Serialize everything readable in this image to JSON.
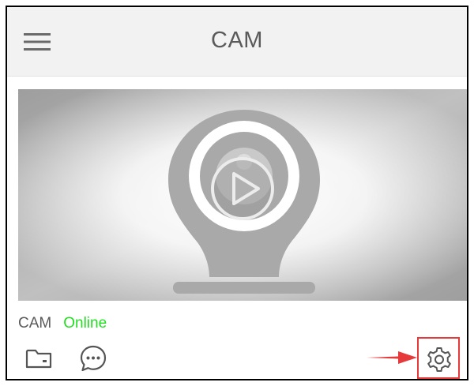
{
  "header": {
    "title": "CAM",
    "menu_icon": "hamburger-menu-icon"
  },
  "preview": {
    "placeholder_icon": "webcam-icon",
    "play_icon": "play-icon"
  },
  "device": {
    "name": "CAM",
    "status": "Online",
    "status_color": "#22dd22"
  },
  "actions": [
    {
      "name": "folder-icon"
    },
    {
      "name": "message-icon"
    },
    {
      "name": "gear-icon"
    }
  ],
  "annotation": {
    "color": "#e63a3a",
    "arrow_icon": "red-arrow-icon",
    "highlight": "highlight-box"
  }
}
